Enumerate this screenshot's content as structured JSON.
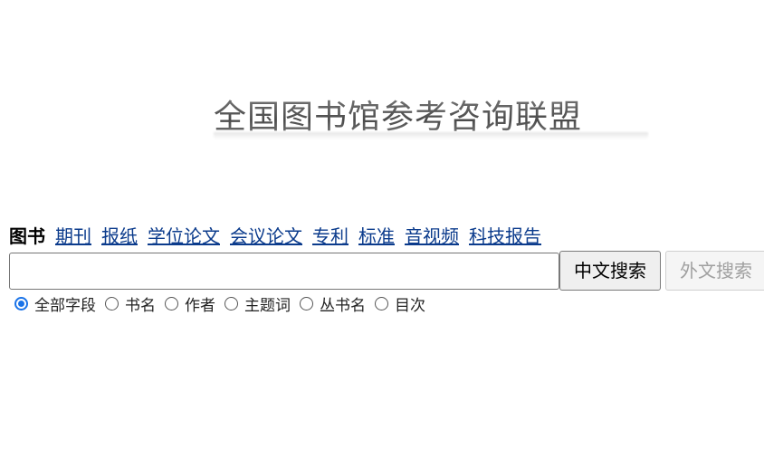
{
  "logo": {
    "text": "全国图书馆参考咨询联盟"
  },
  "tabs": [
    {
      "label": "图书",
      "active": true
    },
    {
      "label": "期刊",
      "active": false
    },
    {
      "label": "报纸",
      "active": false
    },
    {
      "label": "学位论文",
      "active": false
    },
    {
      "label": "会议论文",
      "active": false
    },
    {
      "label": "专利",
      "active": false
    },
    {
      "label": "标准",
      "active": false
    },
    {
      "label": "音视频",
      "active": false
    },
    {
      "label": "科技报告",
      "active": false
    }
  ],
  "search": {
    "value": "",
    "chinese_button": "中文搜索",
    "foreign_button": "外文搜索"
  },
  "fields": [
    {
      "label": "全部字段",
      "checked": true
    },
    {
      "label": "书名",
      "checked": false
    },
    {
      "label": "作者",
      "checked": false
    },
    {
      "label": "主题词",
      "checked": false
    },
    {
      "label": "丛书名",
      "checked": false
    },
    {
      "label": "目次",
      "checked": false
    }
  ],
  "colors": {
    "link": "#0b3b8c",
    "radio_accent": "#1a73e8",
    "disabled_text": "#a0a0a0"
  }
}
